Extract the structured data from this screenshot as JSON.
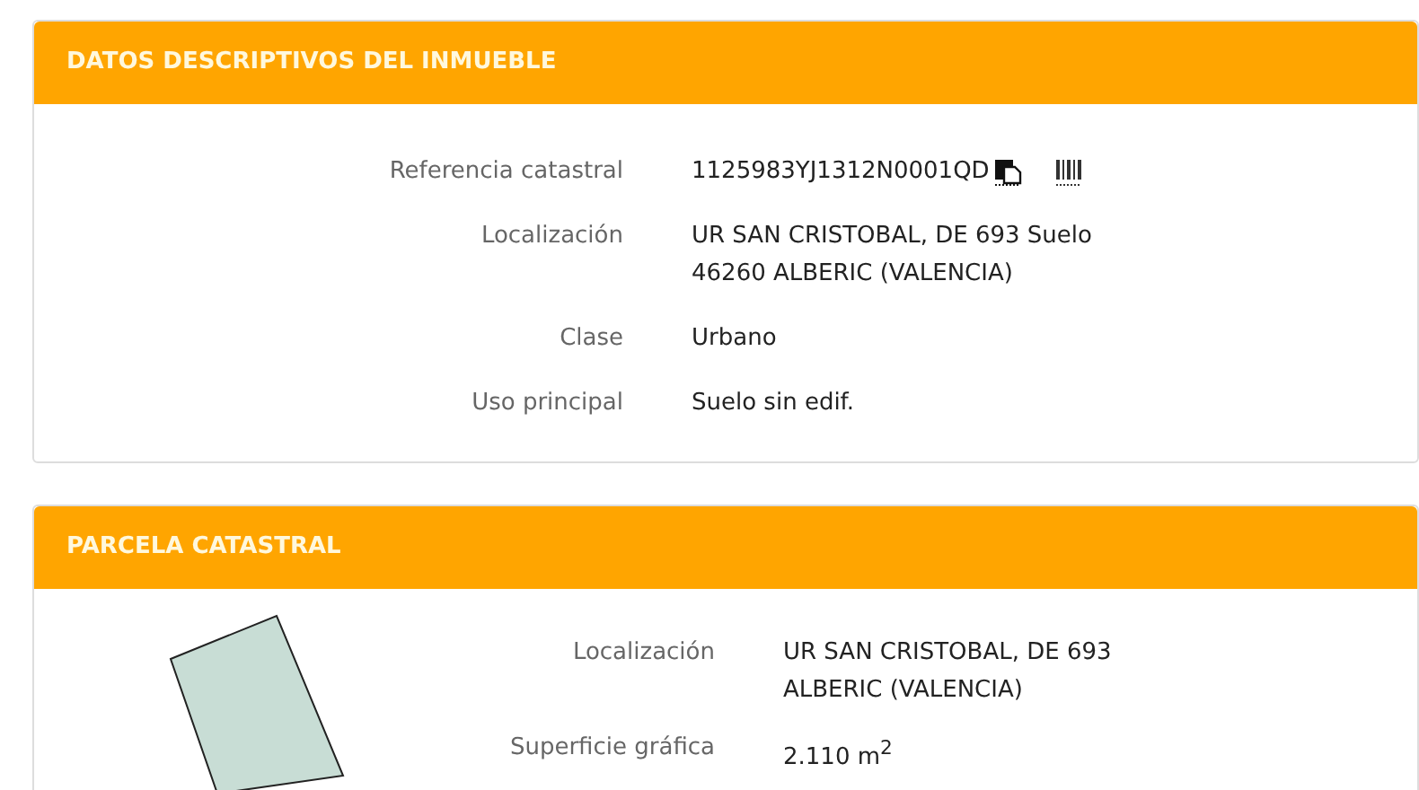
{
  "sections": [
    {
      "title": "DATOS DESCRIPTIVOS DEL INMUEBLE",
      "kind": "fields",
      "rows": [
        {
          "label": "Referencia catastral",
          "value": "1125983YJ1312N0001QD",
          "icons": true
        },
        {
          "label": "Localización",
          "value": "UR SAN CRISTOBAL, DE 693 Suelo\n46260 ALBERIC (VALENCIA)"
        },
        {
          "label": "Clase",
          "value": "Urbano"
        },
        {
          "label": "Uso principal",
          "value": "Suelo sin edif."
        }
      ]
    },
    {
      "title": "PARCELA CATASTRAL",
      "kind": "parcel",
      "rows": [
        {
          "label": "Localización",
          "value": "UR SAN CRISTOBAL, DE 693\nALBERIC (VALENCIA)"
        },
        {
          "label": "Superficie gráfica",
          "value": "2.110 m$^{2}$"
        }
      ]
    }
  ]
}
